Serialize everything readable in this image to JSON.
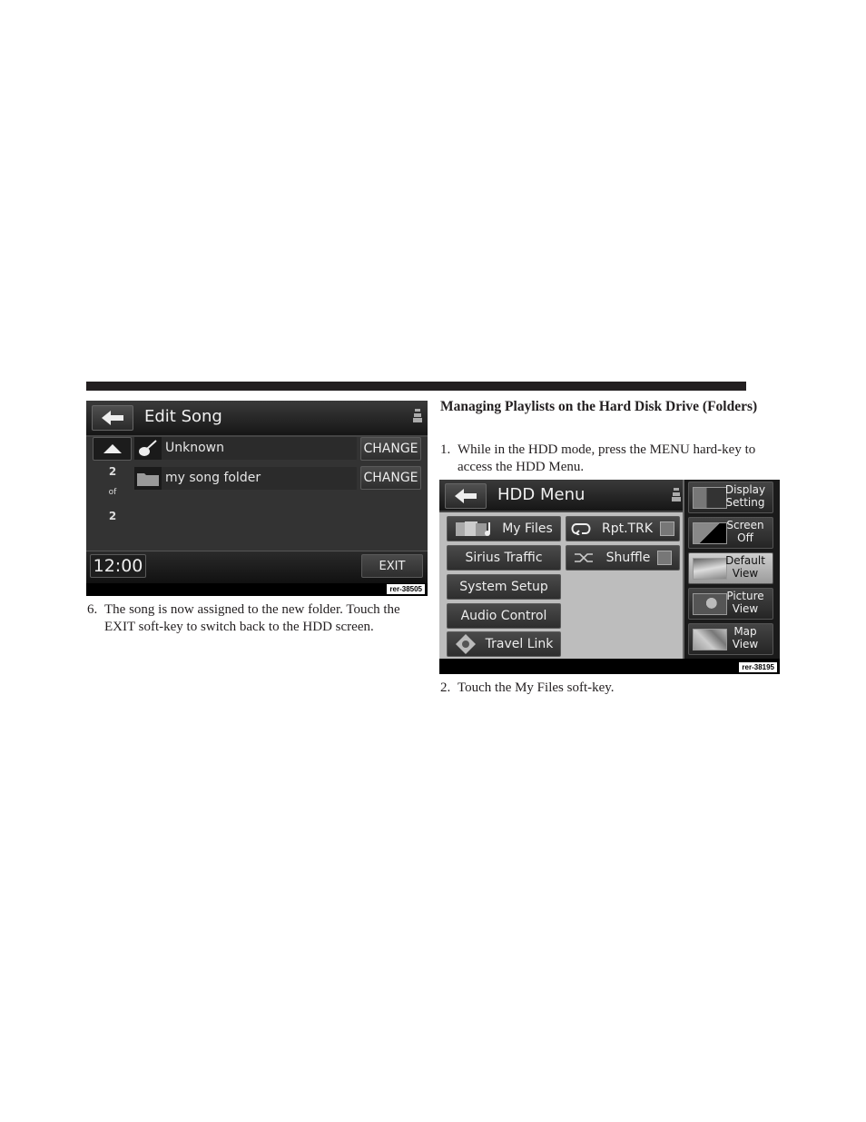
{
  "page": {
    "left_column": {
      "step6": {
        "number": "6.",
        "text": "The song is now assigned to the new folder. Touch the EXIT soft-key to switch back to the HDD screen."
      }
    },
    "right_column": {
      "heading": "Managing Playlists on the Hard Disk Drive (Folders)",
      "step1": {
        "number": "1.",
        "text": "While in the HDD mode, press the MENU hard-key to access the HDD Menu."
      },
      "step2": {
        "number": "2.",
        "text": "Touch the My Files soft-key."
      }
    }
  },
  "edit_song_screen": {
    "title": "Edit Song",
    "back_icon": "left-arrow-icon",
    "seat_icon": "seat-icon",
    "rows": [
      {
        "icon": "guitar-icon",
        "label": "Unknown",
        "button": "CHANGE"
      },
      {
        "icon": "folder-icon",
        "label": "my song folder",
        "button": "CHANGE"
      }
    ],
    "scroll_up_icon": "up-triangle-icon",
    "page_current": "2",
    "page_of": "of",
    "page_total": "2",
    "clock": "12:00",
    "exit_label": "EXIT",
    "caption": "rer-38505"
  },
  "hdd_menu_screen": {
    "title": "HDD Menu",
    "back_icon": "left-arrow-icon",
    "seat_icon": "seat-icon",
    "left_buttons": [
      {
        "label": "My Files",
        "icon": "media-files-icon"
      },
      {
        "label": "Sirius Traffic"
      },
      {
        "label": "System Setup"
      },
      {
        "label": "Audio Control"
      },
      {
        "label": "Travel Link",
        "icon": "travel-link-icon"
      }
    ],
    "toggles": [
      {
        "label": "Rpt.TRK",
        "icon": "repeat-icon",
        "checked": false
      },
      {
        "label": "Shuffle",
        "icon": "shuffle-icon",
        "checked": false
      }
    ],
    "side_buttons": [
      {
        "line1": "Display",
        "line2": "Setting",
        "active": false
      },
      {
        "line1": "Screen",
        "line2": "Off",
        "active": false
      },
      {
        "line1": "Default",
        "line2": "View",
        "active": true
      },
      {
        "line1": "Picture",
        "line2": "View",
        "active": false
      },
      {
        "line1": "Map",
        "line2": "View",
        "active": false
      }
    ],
    "caption": "rer-38195"
  }
}
